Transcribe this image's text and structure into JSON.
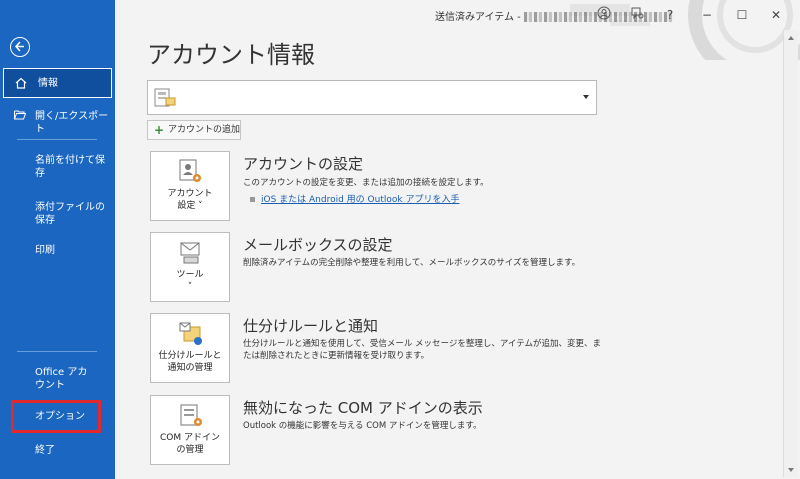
{
  "window": {
    "title": "送信済みアイテム -",
    "controls": {
      "help": "?",
      "minimize": "−",
      "maximize": "☐",
      "close": "✕"
    }
  },
  "nav": {
    "back_icon": "back-arrow-icon",
    "items": [
      {
        "label": "情報",
        "selected": true,
        "icon": "home-icon"
      },
      {
        "label": "開く/エクスポート",
        "icon": "folder-open-icon"
      },
      {
        "label_line1": "名前を付けて保",
        "label_line2": "存"
      },
      {
        "label_line1": "添付ファイルの",
        "label_line2": "保存"
      },
      {
        "label": "印刷"
      },
      {
        "label_line1": "Office アカ",
        "label_line2": "ウント"
      },
      {
        "label": "オプション",
        "highlighted": true
      },
      {
        "label": "終了"
      }
    ]
  },
  "main": {
    "page_title": "アカウント情報",
    "add_account_label": "アカウントの追加",
    "sections": [
      {
        "tile_line1": "アカウント",
        "tile_line2": "設定 ˅",
        "title": "アカウントの設定",
        "description": "このアカウントの設定を変更、または追加の接続を設定します。",
        "link": "iOS または Android 用の Outlook アプリを入手"
      },
      {
        "tile_line1": "ツール",
        "tile_line2": "˅",
        "title": "メールボックスの設定",
        "description": "削除済みアイテムの完全削除や整理を利用して、メールボックスのサイズを管理します。"
      },
      {
        "tile_line1": "仕分けルールと",
        "tile_line2": "通知の管理",
        "title": "仕分けルールと通知",
        "description_line1": "仕分けルールと通知を使用して、受信メール メッセージを整理し、アイテムが追加、変更、ま",
        "description_line2": "たは削除されたときに更新情報を受け取ります。"
      },
      {
        "tile_line1": "COM アドイン",
        "tile_line2": "の管理",
        "title": "無効になった COM アドインの表示",
        "description": "Outlook の機能に影響を与える COM アドインを管理します。"
      }
    ]
  },
  "colors": {
    "nav_bg": "#1a66c0",
    "highlight": "#e0282e",
    "link": "#1a5fb4"
  }
}
